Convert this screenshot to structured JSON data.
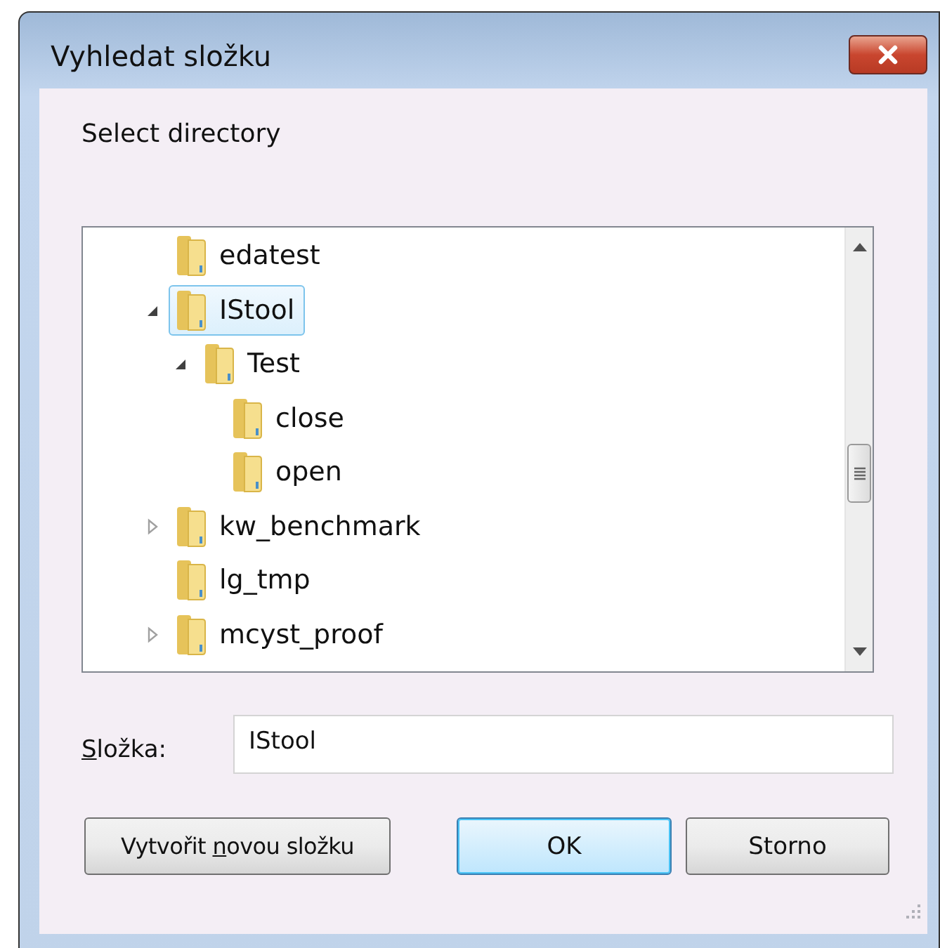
{
  "window": {
    "title": "Vyhledat složku"
  },
  "prompt": "Select directory",
  "tree": [
    {
      "name": "edatest",
      "selected": false
    },
    {
      "name": "IStool",
      "selected": true,
      "expanded": true,
      "children": [
        {
          "name": "Test",
          "selected": false,
          "expanded": true,
          "children": [
            {
              "name": "close",
              "selected": false
            },
            {
              "name": "open",
              "selected": false
            }
          ]
        }
      ]
    },
    {
      "name": "kw_benchmark",
      "selected": false,
      "expanded": false
    },
    {
      "name": "lg_tmp",
      "selected": false
    },
    {
      "name": "mcyst_proof",
      "selected": false,
      "expanded": false
    }
  ],
  "folder_field": {
    "label": {
      "key": "S",
      "post": "ložka:"
    },
    "value": "IStool"
  },
  "buttons": [
    {
      "kind": "action",
      "label": {
        "pre": "Vytvořit ",
        "key": "n",
        "post": "ovou složku"
      }
    },
    {
      "kind": "default",
      "label": {
        "pre": "OK"
      }
    },
    {
      "kind": "normal",
      "label": {
        "pre": "Storno"
      }
    }
  ]
}
